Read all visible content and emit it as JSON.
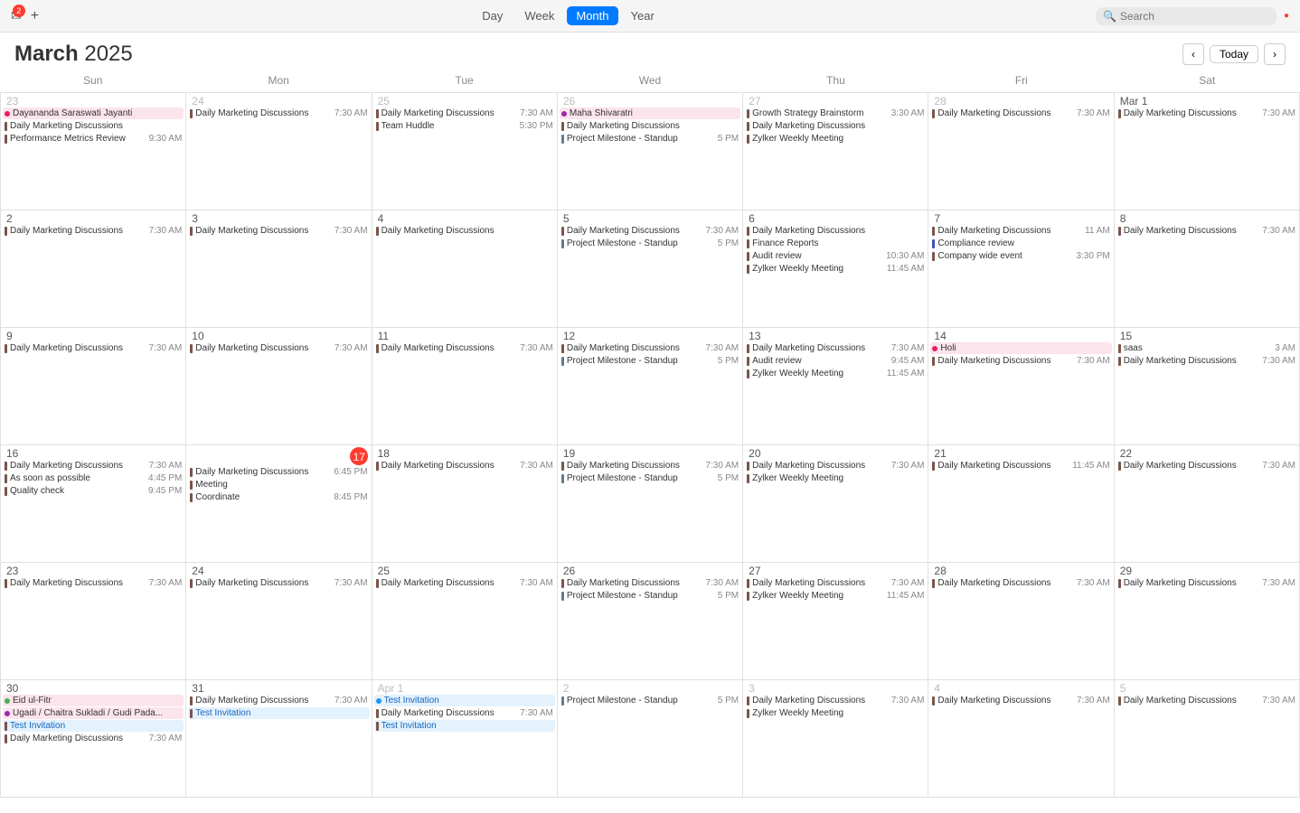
{
  "toolbar": {
    "mail_icon": "✉",
    "mail_badge": "2",
    "add_icon": "+",
    "views": [
      "Day",
      "Week",
      "Month",
      "Year"
    ],
    "active_view": "Month",
    "search_placeholder": "Search"
  },
  "calendar": {
    "title_bold": "March",
    "title_light": "2025",
    "today_label": "Today",
    "days_of_week": [
      "Sun",
      "Mon",
      "Tue",
      "Wed",
      "Thu",
      "Fri",
      "Sat"
    ],
    "weeks": [
      {
        "days": [
          {
            "num": "23",
            "other": true,
            "events": [
              {
                "type": "dot",
                "color": "#e91e63",
                "title": "Dayananda Saraswati Jayanti",
                "time": ""
              },
              {
                "type": "bar",
                "color": "#795548",
                "title": "Daily Marketing Discussions",
                "time": ""
              },
              {
                "type": "bar",
                "color": "#795548",
                "title": "Performance Metrics Review",
                "time": "9:30 AM"
              }
            ]
          },
          {
            "num": "24",
            "other": true,
            "events": [
              {
                "type": "bar",
                "color": "#795548",
                "title": "Daily Marketing Discussions",
                "time": "7:30 AM"
              }
            ]
          },
          {
            "num": "25",
            "other": true,
            "events": [
              {
                "type": "bar",
                "color": "#795548",
                "title": "Daily Marketing Discussions",
                "time": "7:30 AM"
              },
              {
                "type": "bar",
                "color": "#795548",
                "title": "Team Huddle",
                "time": "5:30 PM"
              }
            ]
          },
          {
            "num": "26",
            "other": true,
            "events": [
              {
                "type": "dot",
                "color": "#9c27b0",
                "title": "Maha Shivaratri",
                "time": ""
              },
              {
                "type": "bar",
                "color": "#795548",
                "title": "Daily Marketing Discussions",
                "time": ""
              },
              {
                "type": "bar",
                "color": "#607d8b",
                "title": "Project Milestone - Standup",
                "time": "5 PM"
              }
            ]
          },
          {
            "num": "27",
            "other": true,
            "events": [
              {
                "type": "bar",
                "color": "#795548",
                "title": "Growth Strategy Brainstorm",
                "time": "3:30 AM"
              },
              {
                "type": "bar",
                "color": "#795548",
                "title": "Daily Marketing Discussions",
                "time": ""
              },
              {
                "type": "bar",
                "color": "#795548",
                "title": "Zylker Weekly Meeting",
                "time": ""
              }
            ]
          },
          {
            "num": "28",
            "other": true,
            "events": [
              {
                "type": "bar",
                "color": "#795548",
                "title": "Daily Marketing Discussions",
                "time": "7:30 AM"
              }
            ]
          },
          {
            "num": "Mar 1",
            "other": false,
            "is_march_start": true,
            "events": [
              {
                "type": "bar",
                "color": "#795548",
                "title": "Daily Marketing Discussions",
                "time": "7:30 AM"
              }
            ]
          }
        ]
      },
      {
        "days": [
          {
            "num": "2",
            "events": [
              {
                "type": "bar",
                "color": "#795548",
                "title": "Daily Marketing Discussions",
                "time": "7:30 AM"
              }
            ]
          },
          {
            "num": "3",
            "events": [
              {
                "type": "bar",
                "color": "#795548",
                "title": "Daily Marketing Discussions",
                "time": "7:30 AM"
              }
            ]
          },
          {
            "num": "4",
            "events": [
              {
                "type": "bar",
                "color": "#795548",
                "title": "Daily Marketing Discussions",
                "time": ""
              }
            ]
          },
          {
            "num": "5",
            "events": [
              {
                "type": "bar",
                "color": "#795548",
                "title": "Daily Marketing Discussions",
                "time": "7:30 AM"
              },
              {
                "type": "bar",
                "color": "#607d8b",
                "title": "Project Milestone - Standup",
                "time": "5 PM"
              }
            ]
          },
          {
            "num": "6",
            "events": [
              {
                "type": "bar",
                "color": "#795548",
                "title": "Daily Marketing Discussions",
                "time": ""
              },
              {
                "type": "bar",
                "color": "#795548",
                "title": "Finance Reports",
                "time": ""
              },
              {
                "type": "bar",
                "color": "#795548",
                "title": "Audit review",
                "time": "10:30 AM"
              },
              {
                "type": "bar",
                "color": "#795548",
                "title": "Zylker Weekly Meeting",
                "time": "11:45 AM"
              }
            ]
          },
          {
            "num": "7",
            "events": [
              {
                "type": "bar",
                "color": "#795548",
                "title": "Daily Marketing Discussions",
                "time": "11 AM"
              },
              {
                "type": "bar",
                "color": "#3f51b5",
                "title": "Compliance review",
                "time": ""
              },
              {
                "type": "bar",
                "color": "#795548",
                "title": "Company wide event",
                "time": "3:30 PM"
              }
            ]
          },
          {
            "num": "8",
            "events": [
              {
                "type": "bar",
                "color": "#795548",
                "title": "Daily Marketing Discussions",
                "time": "7:30 AM"
              }
            ]
          }
        ]
      },
      {
        "days": [
          {
            "num": "9",
            "events": [
              {
                "type": "bar",
                "color": "#795548",
                "title": "Daily Marketing Discussions",
                "time": "7:30 AM"
              }
            ]
          },
          {
            "num": "10",
            "events": [
              {
                "type": "bar",
                "color": "#795548",
                "title": "Daily Marketing Discussions",
                "time": "7:30 AM"
              }
            ]
          },
          {
            "num": "11",
            "events": [
              {
                "type": "bar",
                "color": "#795548",
                "title": "Daily Marketing Discussions",
                "time": "7:30 AM"
              }
            ]
          },
          {
            "num": "12",
            "events": [
              {
                "type": "bar",
                "color": "#795548",
                "title": "Daily Marketing Discussions",
                "time": "7:30 AM"
              },
              {
                "type": "bar",
                "color": "#607d8b",
                "title": "Project Milestone - Standup",
                "time": "5 PM"
              }
            ]
          },
          {
            "num": "13",
            "events": [
              {
                "type": "bar",
                "color": "#795548",
                "title": "Daily Marketing Discussions",
                "time": "7:30 AM"
              },
              {
                "type": "bar",
                "color": "#795548",
                "title": "Audit review",
                "time": "9:45 AM"
              },
              {
                "type": "bar",
                "color": "#795548",
                "title": "Zylker Weekly Meeting",
                "time": "11:45 AM"
              }
            ]
          },
          {
            "num": "14",
            "events": [
              {
                "type": "dot",
                "color": "#e91e63",
                "title": "Holi",
                "time": ""
              },
              {
                "type": "bar",
                "color": "#795548",
                "title": "Daily Marketing Discussions",
                "time": "7:30 AM"
              }
            ]
          },
          {
            "num": "15",
            "events": [
              {
                "type": "bar",
                "color": "#795548",
                "title": "saas",
                "time": "3 AM"
              },
              {
                "type": "bar",
                "color": "#795548",
                "title": "Daily Marketing Discussions",
                "time": "7:30 AM"
              }
            ]
          }
        ]
      },
      {
        "days": [
          {
            "num": "16",
            "events": [
              {
                "type": "bar",
                "color": "#795548",
                "title": "Daily Marketing Discussions",
                "time": "7:30 AM"
              },
              {
                "type": "bar",
                "color": "#795548",
                "title": "As soon as possible",
                "time": "4:45 PM"
              },
              {
                "type": "bar",
                "color": "#795548",
                "title": "Quality check",
                "time": "9:45 PM"
              }
            ]
          },
          {
            "num": "17",
            "today": true,
            "events": [
              {
                "type": "bar",
                "color": "#795548",
                "title": "Daily Marketing Discussions",
                "time": "6:45 PM"
              },
              {
                "type": "bar",
                "color": "#795548",
                "title": "Meeting",
                "time": ""
              },
              {
                "type": "bar",
                "color": "#795548",
                "title": "Coordinate",
                "time": "8:45 PM"
              }
            ]
          },
          {
            "num": "18",
            "events": [
              {
                "type": "bar",
                "color": "#795548",
                "title": "Daily Marketing Discussions",
                "time": "7:30 AM"
              }
            ]
          },
          {
            "num": "19",
            "events": [
              {
                "type": "bar",
                "color": "#795548",
                "title": "Daily Marketing Discussions",
                "time": "7:30 AM"
              },
              {
                "type": "bar",
                "color": "#607d8b",
                "title": "Project Milestone - Standup",
                "time": "5 PM"
              }
            ]
          },
          {
            "num": "20",
            "events": [
              {
                "type": "bar",
                "color": "#795548",
                "title": "Daily Marketing Discussions",
                "time": "7:30 AM"
              },
              {
                "type": "bar",
                "color": "#795548",
                "title": "Zylker Weekly Meeting",
                "time": ""
              }
            ]
          },
          {
            "num": "21",
            "events": [
              {
                "type": "bar",
                "color": "#795548",
                "title": "Daily Marketing Discussions",
                "time": "11:45 AM"
              }
            ]
          },
          {
            "num": "22",
            "events": [
              {
                "type": "bar",
                "color": "#795548",
                "title": "Daily Marketing Discussions",
                "time": "7:30 AM"
              }
            ]
          }
        ]
      },
      {
        "days": [
          {
            "num": "23",
            "events": [
              {
                "type": "bar",
                "color": "#795548",
                "title": "Daily Marketing Discussions",
                "time": "7:30 AM"
              }
            ]
          },
          {
            "num": "24",
            "events": [
              {
                "type": "bar",
                "color": "#795548",
                "title": "Daily Marketing Discussions",
                "time": "7:30 AM"
              }
            ]
          },
          {
            "num": "25",
            "events": [
              {
                "type": "bar",
                "color": "#795548",
                "title": "Daily Marketing Discussions",
                "time": "7:30 AM"
              }
            ]
          },
          {
            "num": "26",
            "events": [
              {
                "type": "bar",
                "color": "#795548",
                "title": "Daily Marketing Discussions",
                "time": "7:30 AM"
              },
              {
                "type": "bar",
                "color": "#607d8b",
                "title": "Project Milestone - Standup",
                "time": "5 PM"
              }
            ]
          },
          {
            "num": "27",
            "events": [
              {
                "type": "bar",
                "color": "#795548",
                "title": "Daily Marketing Discussions",
                "time": "7:30 AM"
              },
              {
                "type": "bar",
                "color": "#795548",
                "title": "Zylker Weekly Meeting",
                "time": "11:45 AM"
              }
            ]
          },
          {
            "num": "28",
            "events": [
              {
                "type": "bar",
                "color": "#795548",
                "title": "Daily Marketing Discussions",
                "time": "7:30 AM"
              }
            ]
          },
          {
            "num": "29",
            "events": [
              {
                "type": "bar",
                "color": "#795548",
                "title": "Daily Marketing Discussions",
                "time": "7:30 AM"
              }
            ]
          }
        ]
      },
      {
        "days": [
          {
            "num": "30",
            "events": [
              {
                "type": "dot",
                "color": "#4caf50",
                "title": "Eid ul-Fitr",
                "time": ""
              },
              {
                "type": "dot",
                "color": "#9c27b0",
                "title": "Ugadi / Chaitra Sukladi / Gudi Pada...",
                "time": ""
              },
              {
                "type": "bar",
                "color": "#795548",
                "title": "Test Invitation",
                "time": ""
              },
              {
                "type": "bar",
                "color": "#795548",
                "title": "Daily Marketing Discussions",
                "time": "7:30 AM"
              }
            ]
          },
          {
            "num": "31",
            "events": [
              {
                "type": "bar",
                "color": "#795548",
                "title": "Daily Marketing Discussions",
                "time": "7:30 AM"
              },
              {
                "type": "bar",
                "color": "#795548",
                "title": "Test Invitation",
                "time": ""
              }
            ]
          },
          {
            "num": "Apr 1",
            "other": true,
            "events": [
              {
                "type": "dot",
                "color": "#2196f3",
                "title": "Test Invitation",
                "time": ""
              },
              {
                "type": "bar",
                "color": "#795548",
                "title": "Daily Marketing Discussions",
                "time": "7:30 AM"
              },
              {
                "type": "bar",
                "color": "#795548",
                "title": "Test Invitation",
                "time": ""
              }
            ]
          },
          {
            "num": "2",
            "other": true,
            "events": [
              {
                "type": "bar",
                "color": "#607d8b",
                "title": "Project Milestone - Standup",
                "time": "5 PM"
              }
            ]
          },
          {
            "num": "3",
            "other": true,
            "events": [
              {
                "type": "bar",
                "color": "#795548",
                "title": "Daily Marketing Discussions",
                "time": "7:30 AM"
              },
              {
                "type": "bar",
                "color": "#795548",
                "title": "Zylker Weekly Meeting",
                "time": ""
              }
            ]
          },
          {
            "num": "4",
            "other": true,
            "events": [
              {
                "type": "bar",
                "color": "#795548",
                "title": "Daily Marketing Discussions",
                "time": "7:30 AM"
              }
            ]
          },
          {
            "num": "5",
            "other": true,
            "events": [
              {
                "type": "bar",
                "color": "#795548",
                "title": "Daily Marketing Discussions",
                "time": "7:30 AM"
              }
            ]
          }
        ]
      }
    ]
  }
}
